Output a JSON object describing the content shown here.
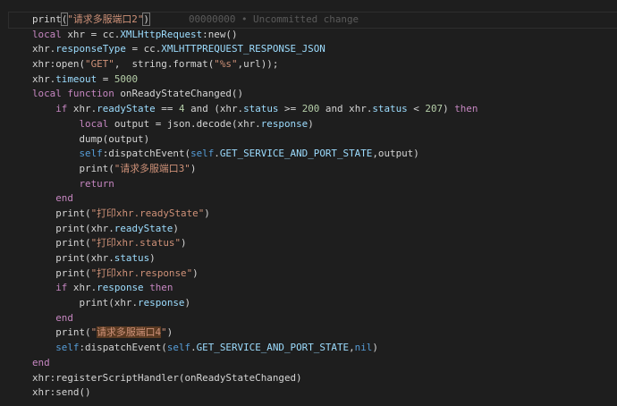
{
  "blame": "00000000 • Uncommitted change",
  "colors": {
    "keyword": "#c586c0",
    "property": "#9cdcfe",
    "string": "#ce9178",
    "number": "#b5cea8",
    "self": "#569cd6",
    "text": "#d4d4d4",
    "background": "#1e1e1e"
  },
  "lines": [
    [
      [
        "plain",
        "print"
      ],
      [
        "plain bracket",
        "("
      ],
      [
        "str",
        "\"请求多服端口2\""
      ],
      [
        "plain bracket",
        ")"
      ]
    ],
    [
      [
        "kw",
        "local"
      ],
      [
        "plain",
        " xhr = cc."
      ],
      [
        "prop",
        "XMLHttpRequest"
      ],
      [
        "plain",
        ":new()"
      ]
    ],
    [
      [
        "plain",
        "xhr."
      ],
      [
        "prop",
        "responseType"
      ],
      [
        "plain",
        " = cc."
      ],
      [
        "prop",
        "XMLHTTPREQUEST_RESPONSE_JSON"
      ]
    ],
    [
      [
        "plain",
        "xhr:open("
      ],
      [
        "str",
        "\"GET\""
      ],
      [
        "plain",
        ",  string.format("
      ],
      [
        "str",
        "\"%s\""
      ],
      [
        "plain",
        ",url));"
      ]
    ],
    [
      [
        "plain",
        "xhr."
      ],
      [
        "prop",
        "timeout"
      ],
      [
        "plain",
        " = "
      ],
      [
        "num",
        "5000"
      ]
    ],
    [
      [
        "kw",
        "local function"
      ],
      [
        "plain",
        " onReadyStateChanged()"
      ]
    ],
    [
      [
        "plain",
        "    "
      ],
      [
        "kw",
        "if"
      ],
      [
        "plain",
        " xhr."
      ],
      [
        "prop",
        "readyState"
      ],
      [
        "plain",
        " == "
      ],
      [
        "num",
        "4"
      ],
      [
        "plain",
        " and (xhr."
      ],
      [
        "prop",
        "status"
      ],
      [
        "plain",
        " >= "
      ],
      [
        "num",
        "200"
      ],
      [
        "plain",
        " and xhr."
      ],
      [
        "prop",
        "status"
      ],
      [
        "plain",
        " < "
      ],
      [
        "num",
        "207"
      ],
      [
        "plain",
        ") "
      ],
      [
        "kw",
        "then"
      ]
    ],
    [
      [
        "plain",
        "        "
      ],
      [
        "kw",
        "local"
      ],
      [
        "plain",
        " output = json.decode(xhr."
      ],
      [
        "prop",
        "response"
      ],
      [
        "plain",
        ")"
      ]
    ],
    [
      [
        "plain",
        "        dump(output)"
      ]
    ],
    [
      [
        "plain",
        "        "
      ],
      [
        "self",
        "self"
      ],
      [
        "plain",
        ":dispatchEvent("
      ],
      [
        "self",
        "self"
      ],
      [
        "plain",
        "."
      ],
      [
        "prop",
        "GET_SERVICE_AND_PORT_STATE"
      ],
      [
        "plain",
        ",output)"
      ]
    ],
    [
      [
        "plain",
        "        print("
      ],
      [
        "str",
        "\"请求多服端口3\""
      ],
      [
        "plain",
        ")"
      ]
    ],
    [
      [
        "plain",
        "        "
      ],
      [
        "kw",
        "return"
      ]
    ],
    [
      [
        "plain",
        "    "
      ],
      [
        "kw",
        "end"
      ]
    ],
    [
      [
        "plain",
        "    print("
      ],
      [
        "str",
        "\"打印xhr.readyState\""
      ],
      [
        "plain",
        ")"
      ]
    ],
    [
      [
        "plain",
        "    print(xhr."
      ],
      [
        "prop",
        "readyState"
      ],
      [
        "plain",
        ")"
      ]
    ],
    [
      [
        "plain",
        "    print("
      ],
      [
        "str",
        "\"打印xhr.status\""
      ],
      [
        "plain",
        ")"
      ]
    ],
    [
      [
        "plain",
        "    print(xhr."
      ],
      [
        "prop",
        "status"
      ],
      [
        "plain",
        ")"
      ]
    ],
    [
      [
        "plain",
        "    print("
      ],
      [
        "str",
        "\"打印xhr.response\""
      ],
      [
        "plain",
        ")"
      ]
    ],
    [
      [
        "plain",
        "    "
      ],
      [
        "kw",
        "if"
      ],
      [
        "plain",
        " xhr."
      ],
      [
        "prop",
        "response"
      ],
      [
        "plain",
        " "
      ],
      [
        "kw",
        "then"
      ]
    ],
    [
      [
        "plain",
        "        print(xhr."
      ],
      [
        "prop",
        "response"
      ],
      [
        "plain",
        ")"
      ]
    ],
    [
      [
        "plain",
        "    "
      ],
      [
        "kw",
        "end"
      ]
    ],
    [
      [
        "plain",
        "    print("
      ],
      [
        "str",
        "\""
      ],
      [
        "str hl",
        "请求多服端口4"
      ],
      [
        "str",
        "\""
      ],
      [
        "plain",
        ")"
      ]
    ],
    [
      [
        "plain",
        "    "
      ],
      [
        "self",
        "self"
      ],
      [
        "plain",
        ":dispatchEvent("
      ],
      [
        "self",
        "self"
      ],
      [
        "plain",
        "."
      ],
      [
        "prop",
        "GET_SERVICE_AND_PORT_STATE"
      ],
      [
        "plain",
        ","
      ],
      [
        "self",
        "nil"
      ],
      [
        "plain",
        ")"
      ]
    ],
    [
      [
        "kw",
        "end"
      ]
    ],
    [
      [
        "plain",
        "xhr:registerScriptHandler(onReadyStateChanged)"
      ]
    ],
    [
      [
        "plain",
        "xhr:send()"
      ]
    ]
  ]
}
